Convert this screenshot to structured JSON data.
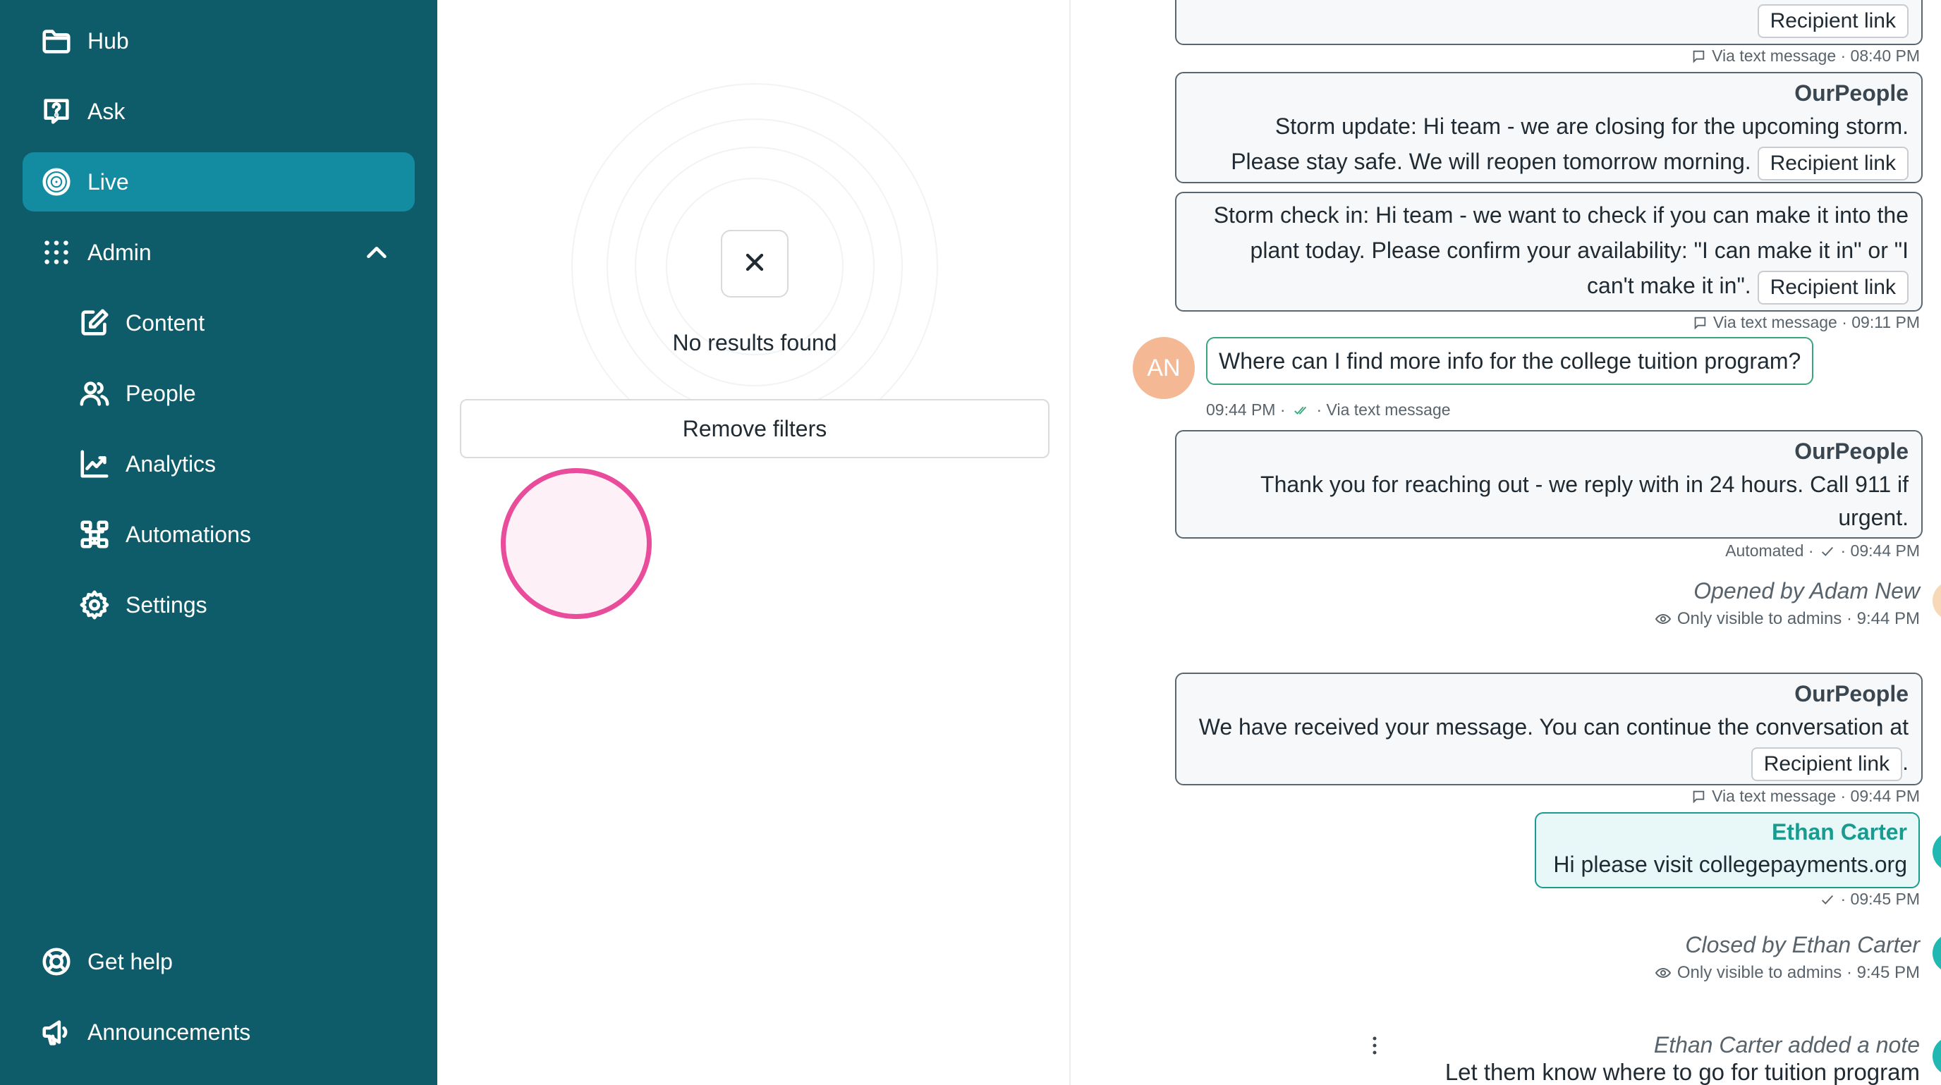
{
  "sidebar": {
    "items": [
      {
        "label": "Hub",
        "icon": "folder-icon"
      },
      {
        "label": "Ask",
        "icon": "question-bubble-icon"
      },
      {
        "label": "Live",
        "icon": "target-icon",
        "active": true
      },
      {
        "label": "Admin",
        "icon": "grid-dots-icon",
        "expanded": true
      }
    ],
    "admin_items": [
      {
        "label": "Content",
        "icon": "edit-icon"
      },
      {
        "label": "People",
        "icon": "users-icon"
      },
      {
        "label": "Analytics",
        "icon": "chart-line-icon"
      },
      {
        "label": "Automations",
        "icon": "automation-icon"
      },
      {
        "label": "Settings",
        "icon": "gear-icon"
      }
    ],
    "footer_items": [
      {
        "label": "Get help",
        "icon": "lifebuoy-icon"
      },
      {
        "label": "Announcements",
        "icon": "megaphone-icon"
      }
    ]
  },
  "filter_panel": {
    "empty_state_text": "No results found",
    "remove_filters_label": "Remove filters"
  },
  "conversation": {
    "messages": [
      {
        "link": "Recipient link",
        "meta": "Via text message · 08:40 PM"
      },
      {
        "sender": "OurPeople",
        "line1": "Storm update: Hi team - we are closing for the upcoming storm.",
        "line2": "Please stay safe. We will reopen tomorrow morning.",
        "link": "Recipient link"
      },
      {
        "line1": "Storm check in: Hi team - we want to check if you can make it into the",
        "line2": "plant today. Please confirm your availability: \"I can make it in\" or \"I",
        "line3": "can't make it in\".",
        "link": "Recipient link",
        "meta": "Via text message · 09:11 PM"
      },
      {
        "avatar": "AN",
        "text": "Where can I find more info for the college tuition program?",
        "time": "09:44 PM ·",
        "via": "· Via text message"
      },
      {
        "sender": "OurPeople",
        "line1": "Thank you for reaching out - we reply with in 24 hours. Call 911 if",
        "line2": "urgent.",
        "meta_a": "Automated ·",
        "meta_b": "· 09:44 PM"
      },
      {
        "sender": "OurPeople",
        "line1": "We have received your message. You can continue the conversation at",
        "link": "Recipient link",
        "meta": "Via text message · 09:44 PM"
      },
      {
        "sender": "Ethan Carter",
        "text": "Hi please visit collegepayments.org",
        "meta": "· 09:45 PM"
      }
    ],
    "events": [
      {
        "title": "Opened by Adam New",
        "sub": "Only visible to admins · 9:44 PM"
      },
      {
        "title": "Closed by Ethan Carter",
        "sub": "Only visible to admins · 9:45 PM"
      },
      {
        "title": "Ethan Carter added a note",
        "sub": "Let them know where to go for tuition program"
      }
    ],
    "colors": {
      "brand_teal": "#0e5c6a",
      "active_teal": "#138ba1",
      "sender_green": "#1a9b8f",
      "avatar_peach": "#f5b895"
    }
  }
}
